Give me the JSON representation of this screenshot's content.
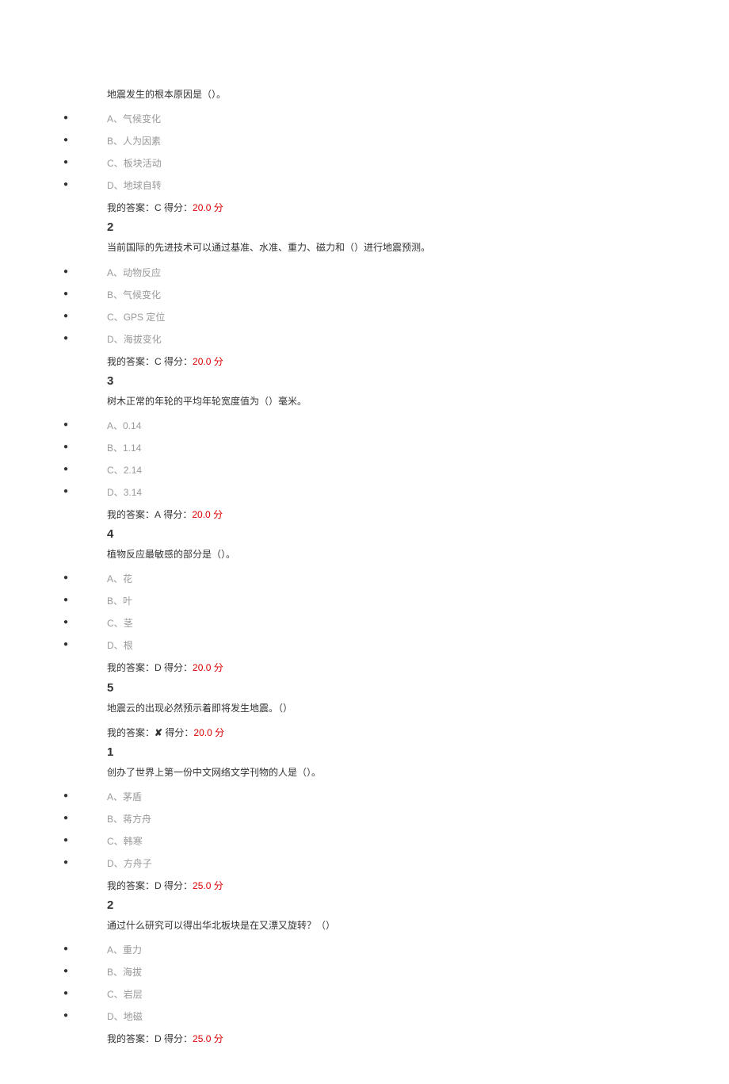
{
  "labels": {
    "my_answer_prefix": "我的答案：",
    "score_prefix": " 得分：",
    "score_unit": " 分"
  },
  "questions": [
    {
      "number": "",
      "text": "地震发生的根本原因是（）。",
      "options": [
        {
          "letter": "A",
          "text": "气候变化"
        },
        {
          "letter": "B",
          "text": "人为因素"
        },
        {
          "letter": "C",
          "text": "板块活动"
        },
        {
          "letter": "D",
          "text": "地球自转"
        }
      ],
      "answer": "C",
      "score": "20.0"
    },
    {
      "number": "2",
      "text": "当前国际的先进技术可以通过基准、水准、重力、磁力和（）进行地震预测。",
      "options": [
        {
          "letter": "A",
          "text": "动物反应"
        },
        {
          "letter": "B",
          "text": "气候变化"
        },
        {
          "letter": "C",
          "text": "GPS 定位"
        },
        {
          "letter": "D",
          "text": "海拔变化"
        }
      ],
      "answer": "C",
      "score": "20.0"
    },
    {
      "number": "3",
      "text": "树木正常的年轮的平均年轮宽度值为（）毫米。",
      "options": [
        {
          "letter": "A",
          "text": "0.14"
        },
        {
          "letter": "B",
          "text": "1.14"
        },
        {
          "letter": "C",
          "text": "2.14"
        },
        {
          "letter": "D",
          "text": "3.14"
        }
      ],
      "answer": "A",
      "score": "20.0"
    },
    {
      "number": "4",
      "text": "植物反应最敏感的部分是（）。",
      "options": [
        {
          "letter": "A",
          "text": "花"
        },
        {
          "letter": "B",
          "text": "叶"
        },
        {
          "letter": "C",
          "text": "茎"
        },
        {
          "letter": "D",
          "text": "根"
        }
      ],
      "answer": "D",
      "score": "20.0"
    },
    {
      "number": "5",
      "text": "地震云的出现必然预示着即将发生地震。（）",
      "options": [],
      "answer": "✘",
      "score": "20.0"
    },
    {
      "number": "1",
      "text": "创办了世界上第一份中文网络文学刊物的人是（）。",
      "options": [
        {
          "letter": "A",
          "text": "茅盾"
        },
        {
          "letter": "B",
          "text": "蒋方舟"
        },
        {
          "letter": "C",
          "text": "韩寒"
        },
        {
          "letter": "D",
          "text": "方舟子"
        }
      ],
      "answer": "D",
      "score": "25.0"
    },
    {
      "number": "2",
      "text": "通过什么研究可以得出华北板块是在又漂又旋转？（）",
      "options": [
        {
          "letter": "A",
          "text": "重力"
        },
        {
          "letter": "B",
          "text": "海拔"
        },
        {
          "letter": "C",
          "text": "岩层"
        },
        {
          "letter": "D",
          "text": "地磁"
        }
      ],
      "answer": "D",
      "score": "25.0"
    }
  ]
}
